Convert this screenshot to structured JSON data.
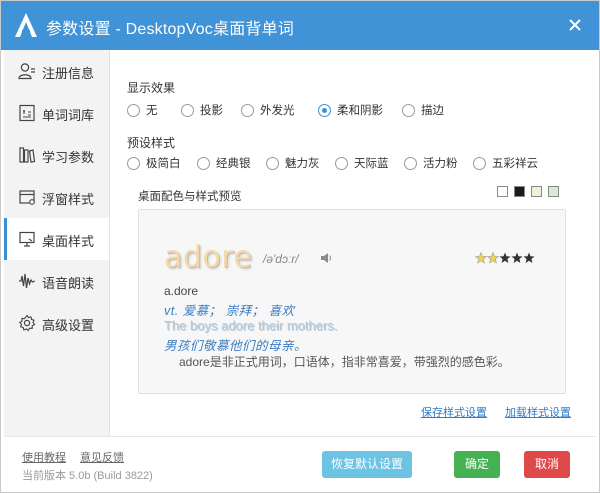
{
  "window": {
    "title": "参数设置 - DesktopVoc桌面背单词",
    "logo_icon": "desktopvoc-logo-icon",
    "close_icon": "close-icon",
    "accent_color": "#3f93d6"
  },
  "sidebar": {
    "items": [
      {
        "label": "注册信息",
        "icon": "user-icon"
      },
      {
        "label": "单词词库",
        "icon": "wordbook-icon"
      },
      {
        "label": "学习参数",
        "icon": "books-icon"
      },
      {
        "label": "浮窗样式",
        "icon": "window-icon"
      },
      {
        "label": "桌面样式",
        "icon": "desktop-icon",
        "active": true
      },
      {
        "label": "语音朗读",
        "icon": "waveform-icon"
      },
      {
        "label": "高级设置",
        "icon": "gear-icon"
      }
    ]
  },
  "display_effect": {
    "label": "显示效果",
    "options": [
      "无",
      "投影",
      "外发光",
      "柔和阴影",
      "描边"
    ],
    "selected": "柔和阴影"
  },
  "preset_style": {
    "label": "预设样式",
    "options": [
      "极简白",
      "经典银",
      "魅力灰",
      "天际蓝",
      "活力粉",
      "五彩祥云"
    ],
    "selected": null
  },
  "preview": {
    "label": "桌面配色与样式预览",
    "swatches": [
      "#ffffff",
      "#1a1a1a",
      "#f3efd9",
      "#d4ecd4"
    ],
    "word": "adore",
    "phonetic": "/ə'dɔːr/",
    "line1": "a.dore",
    "line2": "vt. 爱慕； 崇拜； 喜欢",
    "line3": "The boys adore their mothers.",
    "line4": "男孩们敬慕他们的母亲。",
    "line5": "adore是非正式用词，口语体，指非常喜爱，带强烈的感色彩。",
    "stars_filled": 2,
    "stars_total": 5
  },
  "links": {
    "save_style": "保存样式设置",
    "load_style": "加载样式设置"
  },
  "footer": {
    "tutorial": "使用教程",
    "feedback": "意见反馈",
    "version": "当前版本 5.0b (Build 3822)",
    "restore_default": "恢复默认设置",
    "ok": "确定",
    "cancel": "取消"
  }
}
